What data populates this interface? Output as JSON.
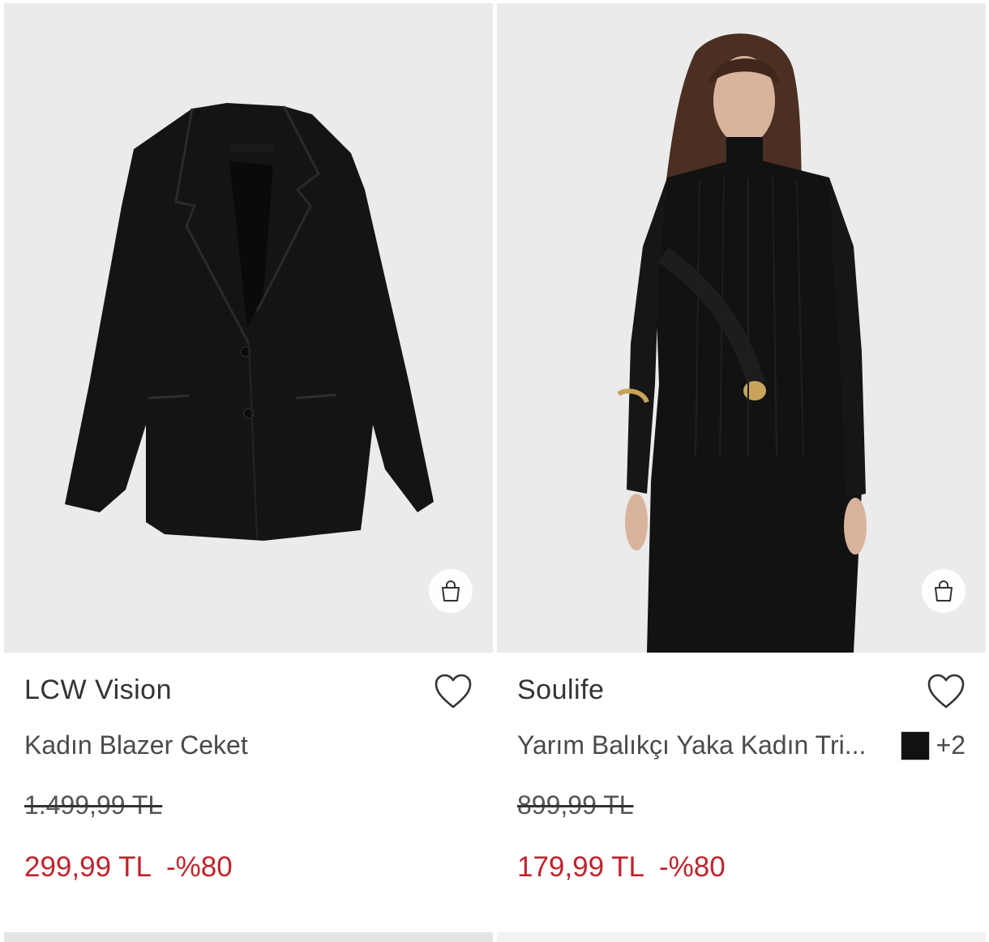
{
  "products": [
    {
      "brand": "LCW Vision",
      "name": "Kadın Blazer Ceket",
      "old_price": "1.499,99 TL",
      "price": "299,99 TL",
      "discount": "-%80",
      "image_icon": "black-blazer-image",
      "bag_icon": "shopping-bag-icon",
      "fav_icon": "heart-icon"
    },
    {
      "brand": "Soulife",
      "name": "Yarım Balıkçı Yaka Kadın Tri...",
      "old_price": "899,99 TL",
      "price": "179,99 TL",
      "discount": "-%80",
      "more_colors": "+2",
      "swatch_color": "#111111",
      "image_icon": "model-in-black-knit-image",
      "bag_icon": "shopping-bag-icon",
      "fav_icon": "heart-icon"
    }
  ],
  "colors": {
    "accent_price": "#c0232c",
    "text": "#333333"
  }
}
